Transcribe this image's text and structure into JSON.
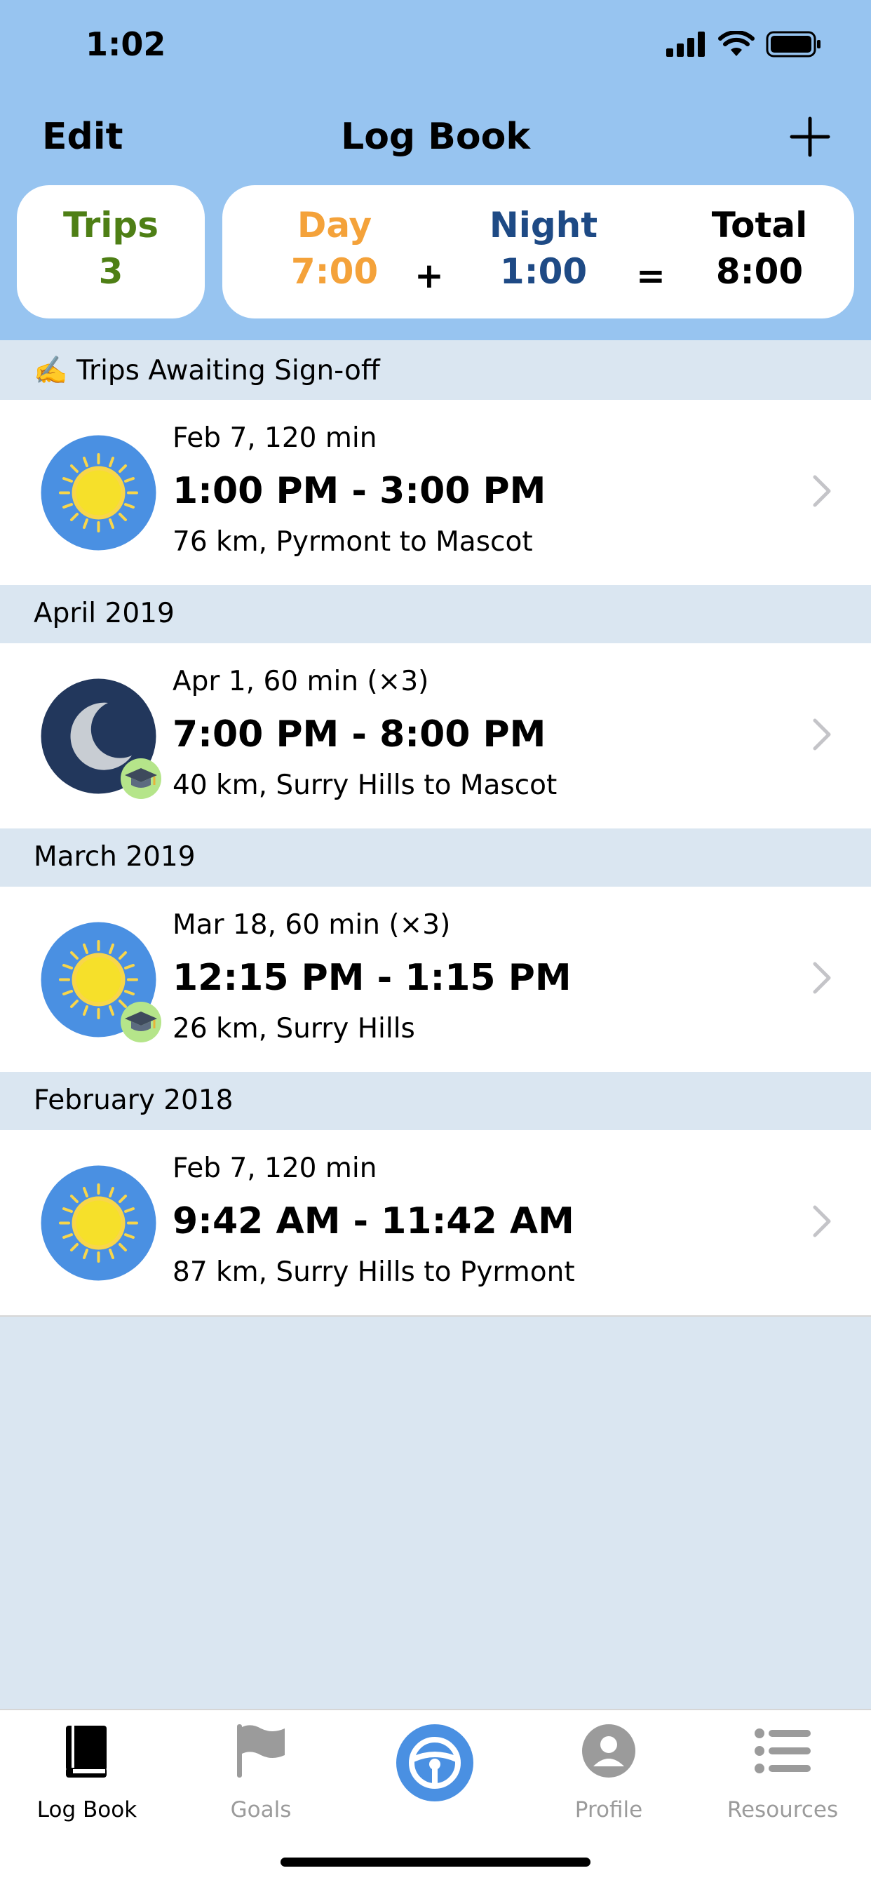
{
  "status_bar": {
    "time": "1:02"
  },
  "nav": {
    "edit_label": "Edit",
    "title": "Log Book"
  },
  "summary": {
    "trips_label": "Trips",
    "trips_value": "3",
    "day_label": "Day",
    "day_value": "7:00",
    "plus": "+",
    "night_label": "Night",
    "night_value": "1:00",
    "equals": "=",
    "total_label": "Total",
    "total_value": "8:00"
  },
  "sections": [
    {
      "title": "✍️ Trips Awaiting Sign-off",
      "trips": [
        {
          "icon": "sun-icon",
          "meta": "Feb 7, 120 min",
          "time": "1:00 PM - 3:00 PM",
          "route": "76 km, Pyrmont to Mascot",
          "badge": false
        }
      ]
    },
    {
      "title": "April 2019",
      "trips": [
        {
          "icon": "moon-icon",
          "meta": "Apr 1, 60 min (×3)",
          "time": "7:00 PM - 8:00 PM",
          "route": "40 km, Surry Hills to Mascot",
          "badge": true
        }
      ]
    },
    {
      "title": "March 2019",
      "trips": [
        {
          "icon": "sun-icon",
          "meta": "Mar 18, 60 min (×3)",
          "time": "12:15 PM - 1:15 PM",
          "route": "26 km, Surry Hills",
          "badge": true
        }
      ]
    },
    {
      "title": "February 2018",
      "trips": [
        {
          "icon": "sun-icon",
          "meta": "Feb 7, 120 min",
          "time": "9:42 AM - 11:42 AM",
          "route": "87 km, Surry Hills to Pyrmont",
          "badge": false
        }
      ]
    }
  ],
  "tabbar": {
    "items": [
      {
        "label": "Log Book",
        "icon": "book-icon",
        "active": true
      },
      {
        "label": "Goals",
        "icon": "flag-icon",
        "active": false
      },
      {
        "label": "",
        "icon": "steering-wheel-icon",
        "active": false
      },
      {
        "label": "Profile",
        "icon": "person-icon",
        "active": false
      },
      {
        "label": "Resources",
        "icon": "list-icon",
        "active": false
      }
    ]
  },
  "colors": {
    "header_bg": "#97C4F0",
    "page_bg": "#DAE6F1",
    "trips_green": "#4E7F15",
    "day_orange": "#F4A23A",
    "night_navy": "#1E4A85",
    "accent_blue": "#4A90E2",
    "tab_inactive": "#9B9B9B"
  }
}
